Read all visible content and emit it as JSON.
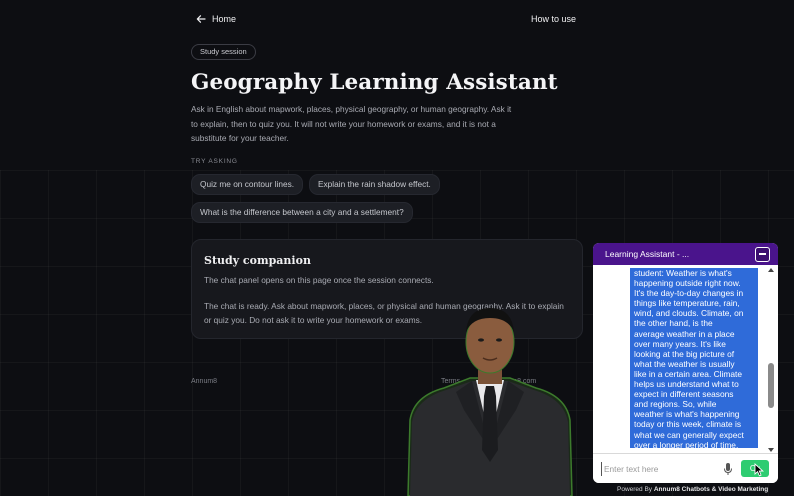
{
  "nav": {
    "home_label": "Home",
    "how_label": "How to use"
  },
  "session_chip": "Study session",
  "title": "Geography Learning Assistant",
  "intro": "Ask in English about mapwork, places, physical geography, or human geography. Ask it to explain, then to quiz you. It will not write your homework or exams, and it is not a substitute for your teacher.",
  "try_label": "TRY ASKING",
  "prompts": [
    "Quiz me on contour lines.",
    "Explain the rain shadow effect.",
    "What is the difference between a city and a settlement?"
  ],
  "card": {
    "title": "Study companion",
    "p1": "The chat panel opens on this page once the session connects.",
    "p2": "The chat is ready. Ask about mapwork, places, or physical and human geography. Ask it to explain or quiz you. Do not ask it to write your homework or exams."
  },
  "footer": {
    "brand": "Annum8",
    "terms": "Terms",
    "contact": "contact@annum8.com"
  },
  "chat": {
    "title": "Learning Assistant - ...",
    "message": "student: Weather is what's\nhappening outside right now.\nIt's the day-to-day changes in\nthings like temperature, rain,\nwind, and clouds. Climate, on\nthe other hand, is the\naverage weather in a place\nover many years. It's like\nlooking at the big picture of\nwhat the weather is usually\nlike in a certain area. Climate\nhelps us understand what to\nexpect in different seasons\nand regions. So, while\nweather is what's happening\ntoday or this week, climate is\nwhat we can generally expect\nover a longer period of time.",
    "input_placeholder": "Enter text here",
    "send_label": "Ok",
    "scroll_position": 0.7
  },
  "powered": {
    "prefix": "Powered By",
    "brand": "Annum8 Chatbots & Video Marketing"
  },
  "colors": {
    "background": "#0d0e12",
    "chat_header": "#4a148c",
    "bubble": "#2f6bd9",
    "send_button": "#2ecc71"
  },
  "icons": {
    "back": "arrow-left-icon",
    "minimize": "minimize-icon",
    "mic": "microphone-icon",
    "cursor": "mouse-pointer-icon"
  }
}
